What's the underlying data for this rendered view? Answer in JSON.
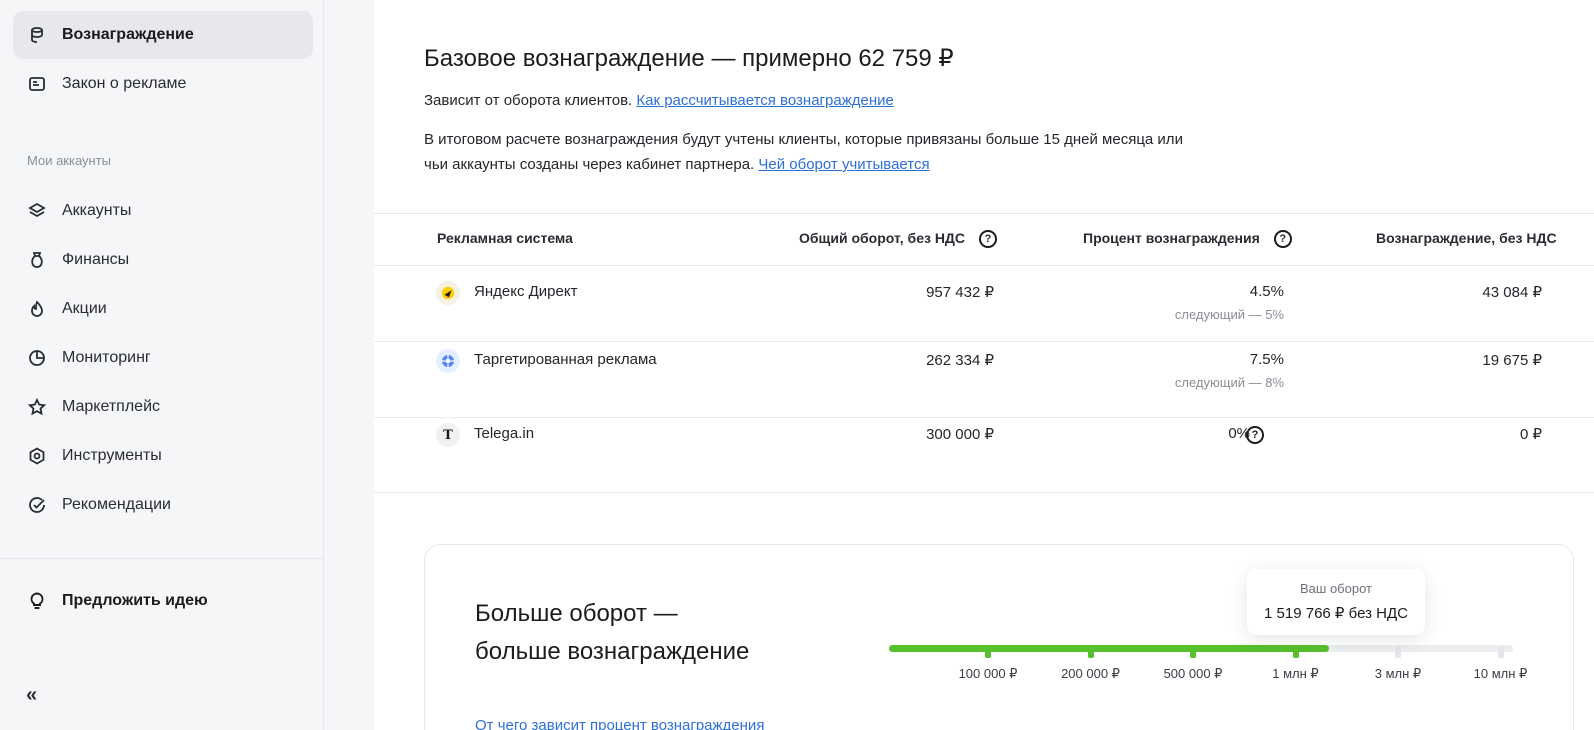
{
  "sidebar": {
    "items_top": [
      {
        "label": "Вознаграждение",
        "icon": "reward-icon",
        "active": true
      },
      {
        "label": "Закон о рекламе",
        "icon": "law-icon"
      }
    ],
    "section_label": "Мои аккаунты",
    "items": [
      {
        "label": "Аккаунты",
        "icon": "layers-icon"
      },
      {
        "label": "Финансы",
        "icon": "money-bag-icon"
      },
      {
        "label": "Акции",
        "icon": "fire-icon"
      },
      {
        "label": "Мониторинг",
        "icon": "pie-chart-icon"
      },
      {
        "label": "Маркетплейс",
        "icon": "star-icon"
      },
      {
        "label": "Инструменты",
        "icon": "gear-icon"
      },
      {
        "label": "Рекомендации",
        "icon": "check-circle-icon"
      }
    ],
    "idea": {
      "label": "Предложить идею",
      "icon": "lightbulb-icon"
    },
    "collapse_glyph": "«"
  },
  "main": {
    "title": "Базовое вознаграждение — примерно 62 759 ₽",
    "p1_text": "Зависит от оборота клиентов. ",
    "p1_link": "Как рассчитывается вознаграждение",
    "p2_text": "В итоговом расчете вознаграждения будут учтены клиенты, которые привязаны больше 15 дней месяца или чьи аккаунты созданы через кабинет партнера. ",
    "p2_link": "Чей оборот учитывается"
  },
  "table": {
    "headers": {
      "system": "Рекламная система",
      "turnover": "Общий оборот, без НДС",
      "percent": "Процент вознаграждения",
      "reward": "Вознаграждение, без НДС"
    },
    "rows": [
      {
        "system": "Яндекс Директ",
        "turnover": "957 432 ₽",
        "percent": "4.5%",
        "next": "следующий — 5%",
        "reward": "43 084 ₽"
      },
      {
        "system": "Таргетированная реклама",
        "turnover": "262 334 ₽",
        "percent": "7.5%",
        "next": "следующий — 8%",
        "reward": "19 675 ₽"
      },
      {
        "system": "Telega.in",
        "turnover": "300 000 ₽",
        "percent": "0%",
        "next": "",
        "reward": "0 ₽"
      }
    ]
  },
  "card": {
    "title_line1": "Больше оборот —",
    "title_line2": "больше вознаграждение",
    "link": "От чего зависит процент вознаграждения",
    "tooltip_label": "Ваш оборот",
    "tooltip_value": "1 519 766 ₽ без НДС",
    "progress_fraction": 0.705,
    "ticks": [
      "100 000 ₽",
      "200 000 ₽",
      "500 000 ₽",
      "1 млн ₽",
      "3 млн ₽",
      "10 млн ₽"
    ],
    "ticks_reached": 4,
    "colors": {
      "fill": "#56c02b",
      "track": "#eceef1"
    }
  },
  "colors": {
    "link": "#2f6fd8",
    "sidebar_bg": "#f5f6f8"
  }
}
